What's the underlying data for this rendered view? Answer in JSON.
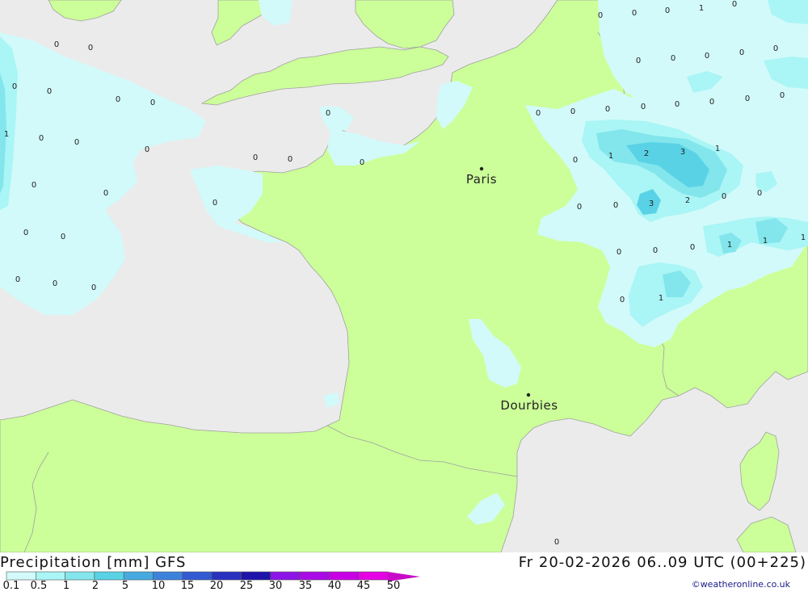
{
  "map": {
    "colors": {
      "sea": "#ebebeb",
      "land": "#ccff99",
      "border": "#a0a0a0"
    },
    "cities": [
      {
        "name": "Paris"
      },
      {
        "name": "Dourbies"
      }
    ],
    "value_labels": [
      "0",
      "0",
      "0",
      "1",
      "0",
      "0",
      "0",
      "0",
      "0",
      "0",
      "0",
      "0",
      "0",
      "0",
      "0",
      "0",
      "0",
      "0",
      "0",
      "0",
      "0",
      "0",
      "1",
      "0",
      "0",
      "0",
      "0",
      "0",
      "0",
      "0",
      "0",
      "0",
      "0",
      "0",
      "0",
      "0",
      "1",
      "2",
      "3",
      "1",
      "0",
      "0",
      "0",
      "0",
      "3",
      "2",
      "0",
      "0",
      "0",
      "0",
      "0",
      "1",
      "1",
      "1",
      "0",
      "1",
      "0",
      "0",
      "0",
      "0"
    ]
  },
  "footer": {
    "title": "Precipitation [mm] GFS",
    "datetime": "Fr 20-02-2026 06..09 UTC (00+225)",
    "credit": "©weatheronline.co.uk"
  },
  "legend": {
    "ticks": [
      "0.1",
      "0.5",
      "1",
      "2",
      "5",
      "10",
      "15",
      "20",
      "25",
      "30",
      "35",
      "40",
      "45",
      "50"
    ],
    "colors": [
      "#d2fafa",
      "#aaf5f5",
      "#82e6ec",
      "#5ad2e6",
      "#46aae0",
      "#3c82dc",
      "#325ad2",
      "#2832be",
      "#1e14aa",
      "#8c14e6",
      "#aa0ae6",
      "#c800e6",
      "#e600e6",
      "#c80ac8"
    ]
  }
}
